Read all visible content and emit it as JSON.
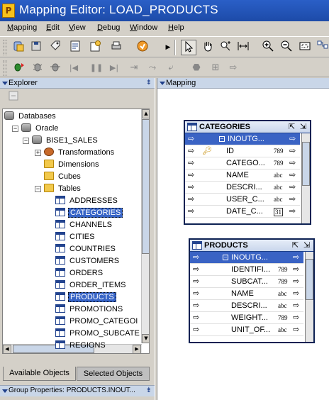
{
  "window": {
    "title": "Mapping Editor: LOAD_PRODUCTS",
    "app_icon_letter": "P"
  },
  "menu": [
    "Mapping",
    "Edit",
    "View",
    "Debug",
    "Window",
    "Help"
  ],
  "menu_underline": [
    "M",
    "E",
    "V",
    "D",
    "W",
    "H"
  ],
  "explorer": {
    "title": "Explorer",
    "tree": [
      {
        "label": "Databases",
        "depth": 0,
        "icon": "database-folder"
      },
      {
        "label": "Oracle",
        "depth": 1,
        "icon": "database"
      },
      {
        "label": "BISE1_SALES",
        "depth": 2,
        "icon": "database"
      },
      {
        "label": "Transformations",
        "depth": 3,
        "icon": "transformations"
      },
      {
        "label": "Dimensions",
        "depth": 3,
        "icon": "dimensions"
      },
      {
        "label": "Cubes",
        "depth": 3,
        "icon": "cubes"
      },
      {
        "label": "Tables",
        "depth": 3,
        "icon": "folder"
      },
      {
        "label": "ADDRESSES",
        "depth": 4,
        "icon": "table"
      },
      {
        "label": "CATEGORIES",
        "depth": 4,
        "icon": "table",
        "selected": true
      },
      {
        "label": "CHANNELS",
        "depth": 4,
        "icon": "table"
      },
      {
        "label": "CITIES",
        "depth": 4,
        "icon": "table"
      },
      {
        "label": "COUNTRIES",
        "depth": 4,
        "icon": "table"
      },
      {
        "label": "CUSTOMERS",
        "depth": 4,
        "icon": "table"
      },
      {
        "label": "ORDERS",
        "depth": 4,
        "icon": "table"
      },
      {
        "label": "ORDER_ITEMS",
        "depth": 4,
        "icon": "table"
      },
      {
        "label": "PRODUCTS",
        "depth": 4,
        "icon": "table",
        "selected": true
      },
      {
        "label": "PROMOTIONS",
        "depth": 4,
        "icon": "table"
      },
      {
        "label": "PROMO_CATEGOI",
        "depth": 4,
        "icon": "table"
      },
      {
        "label": "PROMO_SUBCATE",
        "depth": 4,
        "icon": "table"
      },
      {
        "label": "REGIONS",
        "depth": 4,
        "icon": "table"
      }
    ],
    "tabs": {
      "available": "Available Objects",
      "selected": "Selected Objects"
    },
    "group_properties": "Group Properties: PRODUCTS.INOUT..."
  },
  "mapping": {
    "title": "Mapping",
    "operators": [
      {
        "name": "CATEGORIES",
        "group": "INOUTG...",
        "rows": [
          {
            "name": "ID",
            "type": "789",
            "key": true
          },
          {
            "name": "CATEGO...",
            "type": "789"
          },
          {
            "name": "NAME",
            "type": "abc"
          },
          {
            "name": "DESCRI...",
            "type": "abc"
          },
          {
            "name": "USER_C...",
            "type": "abc"
          },
          {
            "name": "DATE_C...",
            "type": "31"
          }
        ]
      },
      {
        "name": "PRODUCTS",
        "group": "INOUTG...",
        "rows": [
          {
            "name": "IDENTIFI...",
            "type": "789"
          },
          {
            "name": "SUBCAT...",
            "type": "789"
          },
          {
            "name": "NAME",
            "type": "abc"
          },
          {
            "name": "DESCRI...",
            "type": "abc"
          },
          {
            "name": "WEIGHT...",
            "type": "789"
          },
          {
            "name": "UNIT_OF...",
            "type": "abc"
          }
        ]
      }
    ]
  }
}
